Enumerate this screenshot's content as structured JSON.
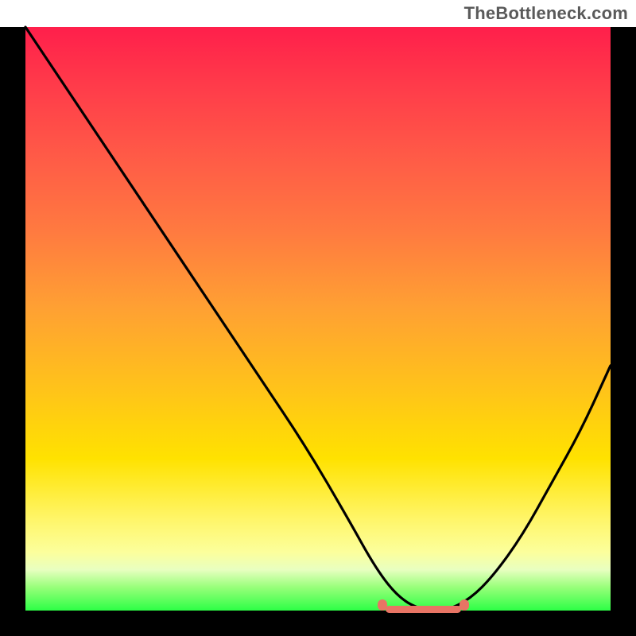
{
  "watermark": "TheBottleneck.com",
  "chart_data": {
    "type": "line",
    "title": "",
    "xlabel": "",
    "ylabel": "",
    "xlim": [
      0,
      100
    ],
    "ylim": [
      0,
      100
    ],
    "series": [
      {
        "name": "bottleneck-curve",
        "x": [
          0,
          8,
          16,
          24,
          32,
          40,
          48,
          55,
          60,
          64,
          68,
          72,
          76,
          80,
          85,
          90,
          95,
          100
        ],
        "y": [
          100,
          88,
          76,
          64,
          52,
          40,
          28,
          16,
          7,
          2,
          0,
          0,
          2,
          6,
          13,
          22,
          31,
          42
        ]
      }
    ],
    "highlight_band": {
      "x_start": 61,
      "x_end": 75,
      "y": 0,
      "color": "#e87464"
    },
    "gradient_stops": [
      {
        "pos": 0.0,
        "color": "#ff1f4b"
      },
      {
        "pos": 0.5,
        "color": "#ffb020"
      },
      {
        "pos": 0.8,
        "color": "#fff000"
      },
      {
        "pos": 1.0,
        "color": "#2dff46"
      }
    ]
  }
}
